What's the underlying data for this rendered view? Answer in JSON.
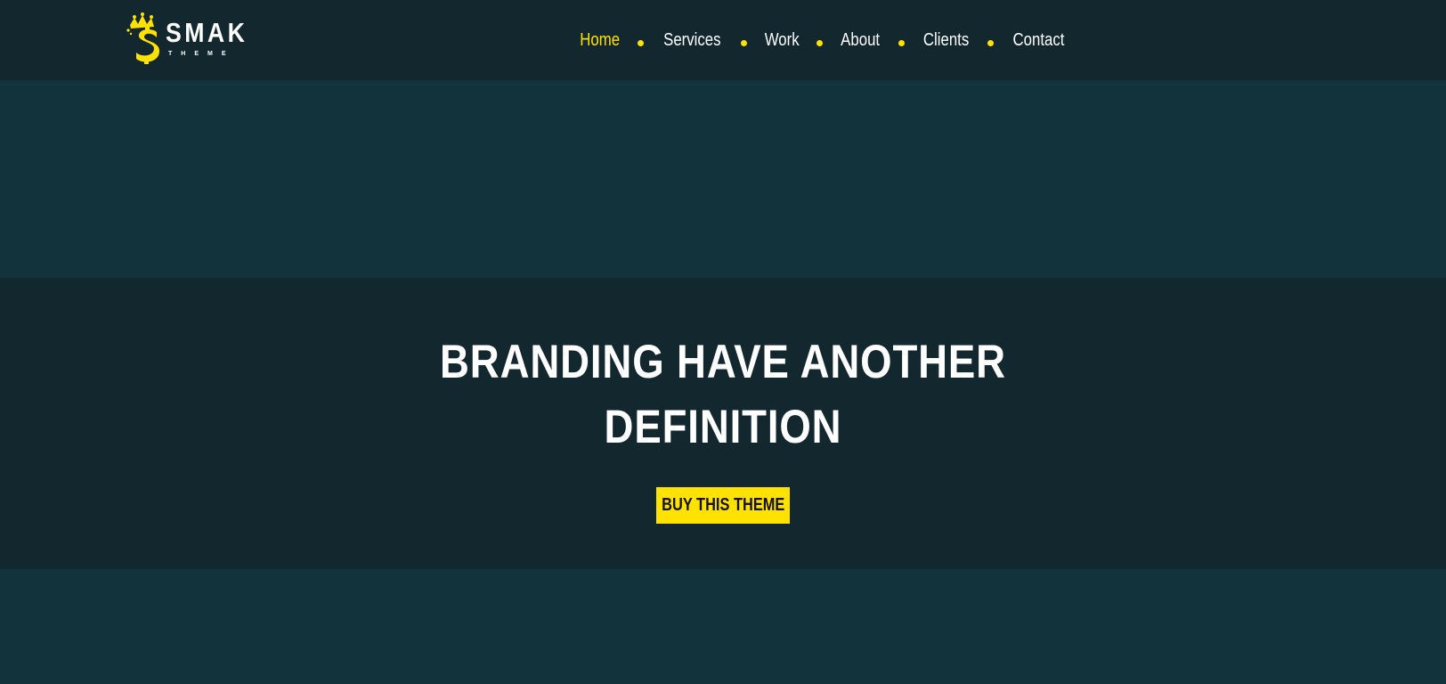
{
  "brand": {
    "name": "SMAK",
    "subtitle": "THEME",
    "logo_icon": "crowned-dollar-icon",
    "accent_color": "#ffe200"
  },
  "nav": {
    "items": [
      {
        "label": "Home",
        "active": true
      },
      {
        "label": "Services",
        "active": false
      },
      {
        "label": "Work",
        "active": false
      },
      {
        "label": "About",
        "active": false
      },
      {
        "label": "Clients",
        "active": false
      },
      {
        "label": "Contact",
        "active": false
      }
    ]
  },
  "hero": {
    "title_line1": "BRANDING HAVE ANOTHER",
    "title_line2": "DEFINITION",
    "cta_label": "BUY THIS THEME"
  },
  "colors": {
    "header_bg": "#13272f",
    "band_bg": "#12333b",
    "hero_bg": "#13272f",
    "text": "#ffffff",
    "accent": "#ffe200"
  }
}
